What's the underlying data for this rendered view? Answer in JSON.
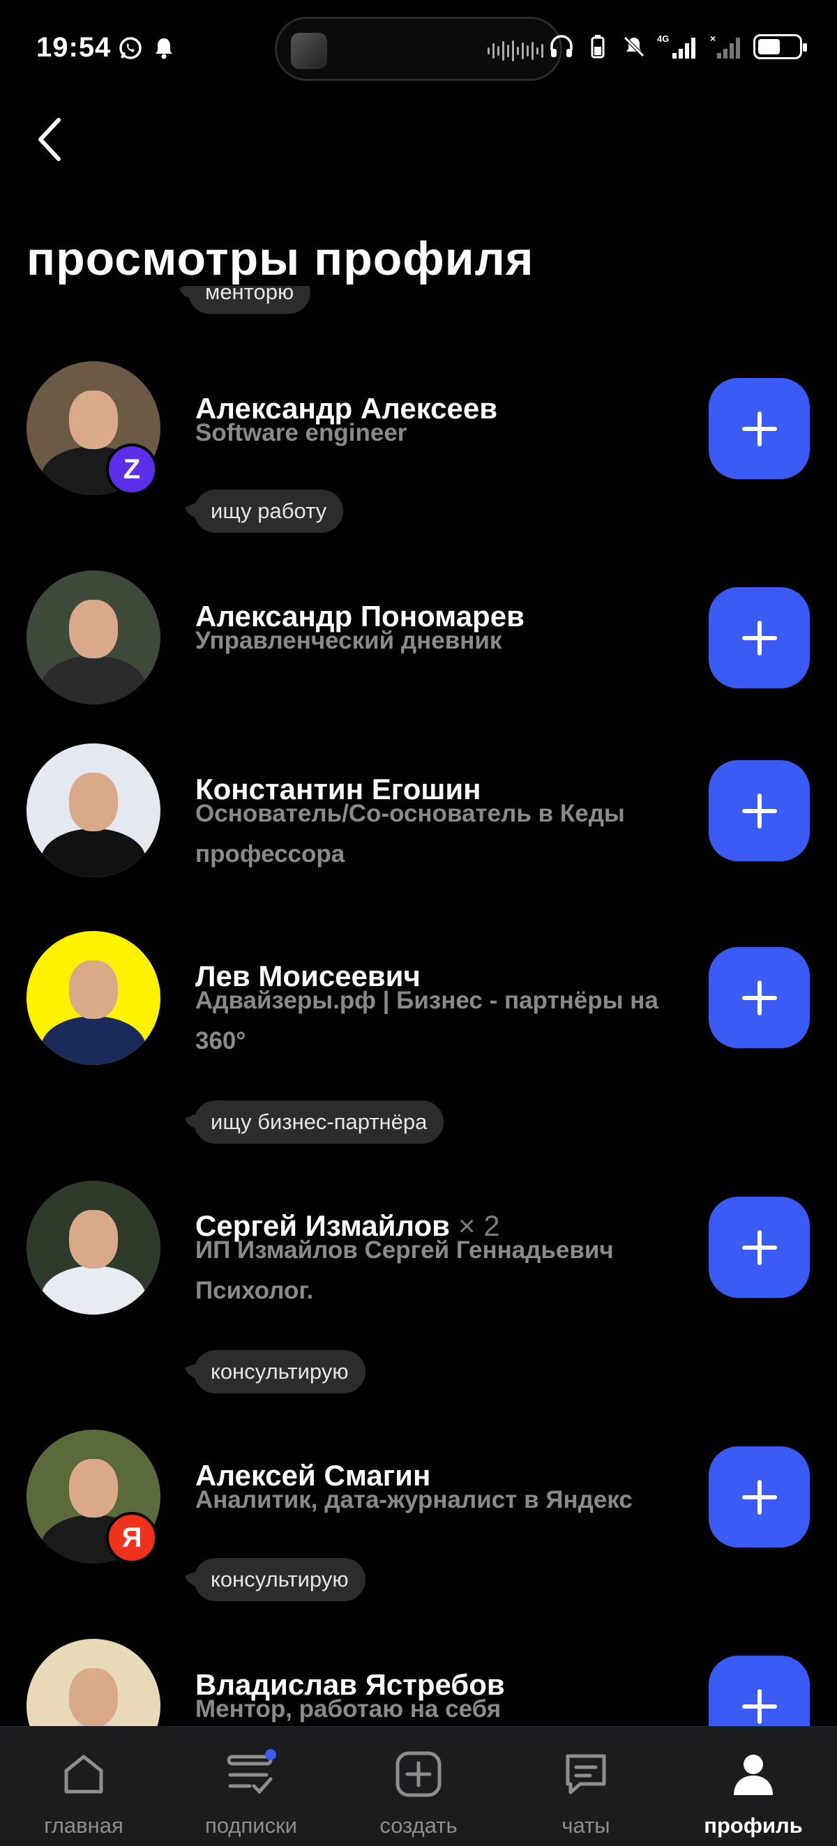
{
  "status_bar": {
    "time": "19:54",
    "network": "4G",
    "battery_level": 0.55,
    "icons": [
      "whatsapp-icon",
      "bell-icon",
      "headphones-icon",
      "battery-saver-icon",
      "mute-icon",
      "signal-icon",
      "signal-icon",
      "battery-icon"
    ]
  },
  "header": {
    "title": "просмотры профиля",
    "back_icon": "chevron-left-icon"
  },
  "partial_tag": "менторю",
  "profiles": [
    {
      "name": "Александр Алексеев",
      "multiplier": "",
      "subtitle": "Software engineer",
      "tag": "ищу работу",
      "badge": "Z",
      "badge_color": "#5b2ee8",
      "avatar_bg": "#6b5a44",
      "shirt": "#1a1a1a"
    },
    {
      "name": "Александр Пономарев",
      "multiplier": "",
      "subtitle": "Управленческий дневник",
      "tag": "",
      "badge": "",
      "badge_color": "",
      "avatar_bg": "#3d4a3a",
      "shirt": "#2b2b2b"
    },
    {
      "name": "Константин Егошин",
      "multiplier": "",
      "subtitle": "Основатель/Со-основатель в Кеды профессора",
      "tag": "",
      "badge": "",
      "badge_color": "",
      "avatar_bg": "#e4e8f0",
      "shirt": "#111111"
    },
    {
      "name": "Лев Моисеевич",
      "multiplier": "",
      "subtitle": "Адвайзеры.рф | Бизнес - партнёры на 360°",
      "tag": "ищу бизнес-партнёра",
      "badge": "",
      "badge_color": "",
      "avatar_bg": "#fff200",
      "shirt": "#1a2a5a"
    },
    {
      "name": "Сергей Измайлов",
      "multiplier": "× 2",
      "subtitle": "ИП Измайлов Сергей Геннадьевич Психолог.",
      "tag": "консультирую",
      "badge": "",
      "badge_color": "",
      "avatar_bg": "#2f3b2a",
      "shirt": "#e8ecf2"
    },
    {
      "name": "Алексей Смагин",
      "multiplier": "",
      "subtitle": "Аналитик, дата-журналист в Яндекс",
      "tag": "консультирую",
      "badge": "Я",
      "badge_color": "#f0321c",
      "avatar_bg": "#5a6a3a",
      "shirt": "#1a1a1a"
    },
    {
      "name": "Владислав Ястребов",
      "multiplier": "",
      "subtitle": "Ментор, работаю на себя",
      "tag": "",
      "badge": "",
      "badge_color": "",
      "avatar_bg": "#e8d9b8",
      "shirt": "#c9b8e8"
    }
  ],
  "bottom_nav": [
    {
      "label": "главная",
      "icon": "home-icon",
      "active": false
    },
    {
      "label": "подписки",
      "icon": "subscriptions-icon",
      "active": false,
      "has_dot": true
    },
    {
      "label": "создать",
      "icon": "plus-square-icon",
      "active": false
    },
    {
      "label": "чаты",
      "icon": "chat-icon",
      "active": false
    },
    {
      "label": "профиль",
      "icon": "person-icon",
      "active": true
    }
  ],
  "colors": {
    "accent": "#3a5cf5",
    "background": "#000000",
    "tag_bg": "#2c2c2c",
    "muted_text": "#8a8a8a"
  }
}
